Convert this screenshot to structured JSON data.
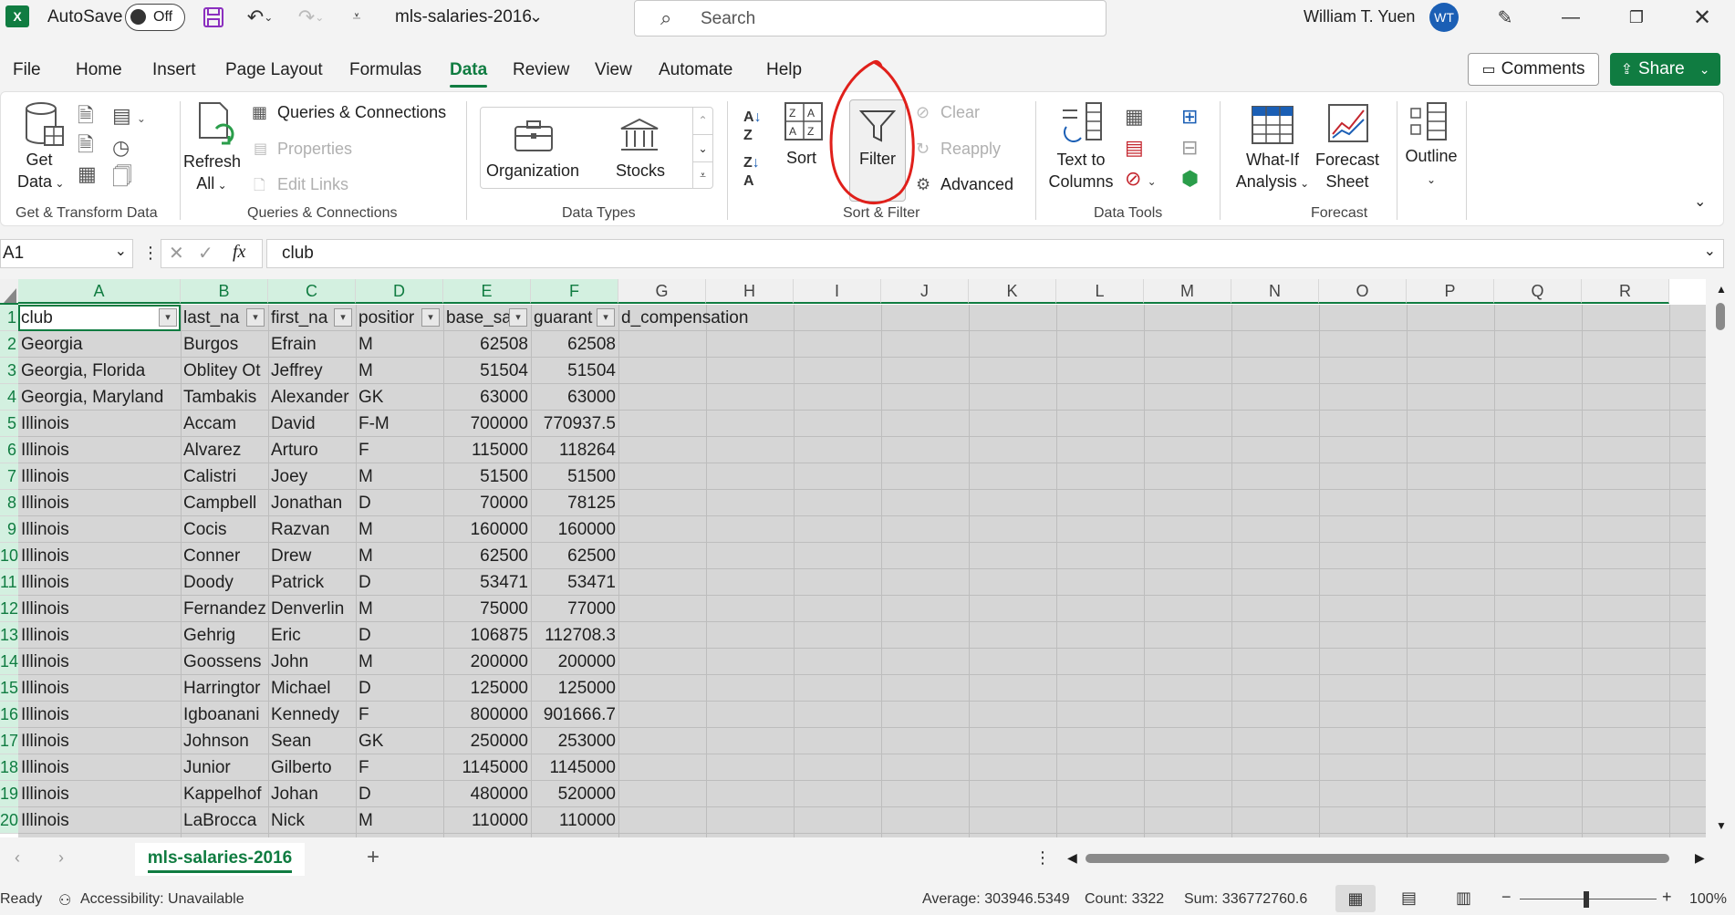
{
  "titlebar": {
    "autosave_label": "AutoSave",
    "autosave_state": "Off",
    "filename": "mls-salaries-2016",
    "search_placeholder": "Search",
    "user_name": "William T. Yuen",
    "user_initials": "WT"
  },
  "tabs": [
    "File",
    "Home",
    "Insert",
    "Page Layout",
    "Formulas",
    "Data",
    "Review",
    "View",
    "Automate",
    "Help"
  ],
  "active_tab": "Data",
  "buttons": {
    "comments": "Comments",
    "share": "Share"
  },
  "ribbon": {
    "get_data": "Get",
    "get_data2": "Data",
    "refresh": "Refresh",
    "refresh2": "All",
    "queries_connections": "Queries & Connections",
    "properties": "Properties",
    "edit_links": "Edit Links",
    "organization": "Organization",
    "stocks": "Stocks",
    "sort": "Sort",
    "filter": "Filter",
    "clear": "Clear",
    "reapply": "Reapply",
    "advanced": "Advanced",
    "text_to": "Text to",
    "columns": "Columns",
    "what_if": "What-If",
    "analysis": "Analysis",
    "forecast": "Forecast",
    "sheet": "Sheet",
    "outline": "Outline",
    "groups": {
      "get_transform": "Get & Transform Data",
      "queries": "Queries & Connections",
      "data_types": "Data Types",
      "sort_filter": "Sort & Filter",
      "data_tools": "Data Tools",
      "forecast": "Forecast"
    }
  },
  "formula_bar": {
    "name_box": "A1",
    "fx": "fx",
    "formula": "club"
  },
  "columns": [
    "A",
    "B",
    "C",
    "D",
    "E",
    "F",
    "G",
    "H",
    "I",
    "J",
    "K",
    "L",
    "M",
    "N",
    "O",
    "P",
    "Q",
    "R"
  ],
  "row_numbers": [
    "1",
    "2",
    "3",
    "4",
    "5",
    "6",
    "7",
    "8",
    "9",
    "10",
    "11",
    "12",
    "13",
    "14",
    "15",
    "16",
    "17",
    "18",
    "19",
    "20"
  ],
  "headers": [
    "club",
    "last_na",
    "first_na",
    "positior",
    "base_sa",
    "guarant",
    "d_compensation"
  ],
  "rows": [
    [
      "Georgia",
      "Burgos",
      "Efrain",
      "M",
      "62508",
      "62508"
    ],
    [
      "Georgia, Florida",
      "Obliteу Ot",
      "Jeffrey",
      "M",
      "51504",
      "51504"
    ],
    [
      "Georgia, Maryland",
      "Tambakis",
      "Alexander",
      "GK",
      "63000",
      "63000"
    ],
    [
      "Illinois",
      "Accam",
      "David",
      "F-M",
      "700000",
      "770937.5"
    ],
    [
      "Illinois",
      "Alvarez",
      "Arturo",
      "F",
      "115000",
      "118264"
    ],
    [
      "Illinois",
      "Calistri",
      "Joey",
      "M",
      "51500",
      "51500"
    ],
    [
      "Illinois",
      "Campbell",
      "Jonathan",
      "D",
      "70000",
      "78125"
    ],
    [
      "Illinois",
      "Cocis",
      "Razvan",
      "M",
      "160000",
      "160000"
    ],
    [
      "Illinois",
      "Conner",
      "Drew",
      "M",
      "62500",
      "62500"
    ],
    [
      "Illinois",
      "Doody",
      "Patrick",
      "D",
      "53471",
      "53471"
    ],
    [
      "Illinois",
      "Fernandez",
      "Denverlin",
      "M",
      "75000",
      "77000"
    ],
    [
      "Illinois",
      "Gehrig",
      "Eric",
      "D",
      "106875",
      "112708.3"
    ],
    [
      "Illinois",
      "Goossens",
      "John",
      "M",
      "200000",
      "200000"
    ],
    [
      "Illinois",
      "Harringtor",
      "Michael",
      "D",
      "125000",
      "125000"
    ],
    [
      "Illinois",
      "Igboanani",
      "Kennedy",
      "F",
      "800000",
      "901666.7"
    ],
    [
      "Illinois",
      "Johnson",
      "Sean",
      "GK",
      "250000",
      "253000"
    ],
    [
      "Illinois",
      "Junior",
      "Gilberto",
      "F",
      "1145000",
      "1145000"
    ],
    [
      "Illinois",
      "Kappelhof",
      "Johan",
      "D",
      "480000",
      "520000"
    ],
    [
      "Illinois",
      "LaBrocca",
      "Nick",
      "M",
      "110000",
      "110000"
    ]
  ],
  "sheet_tab": "mls-salaries-2016",
  "status": {
    "ready": "Ready",
    "accessibility": "Accessibility: Unavailable",
    "average": "Average: 303946.5349",
    "count": "Count: 3322",
    "sum": "Sum: 336772760.6",
    "zoom": "100%"
  },
  "colors": {
    "accent": "#107c41",
    "annotation": "#e0201b"
  }
}
